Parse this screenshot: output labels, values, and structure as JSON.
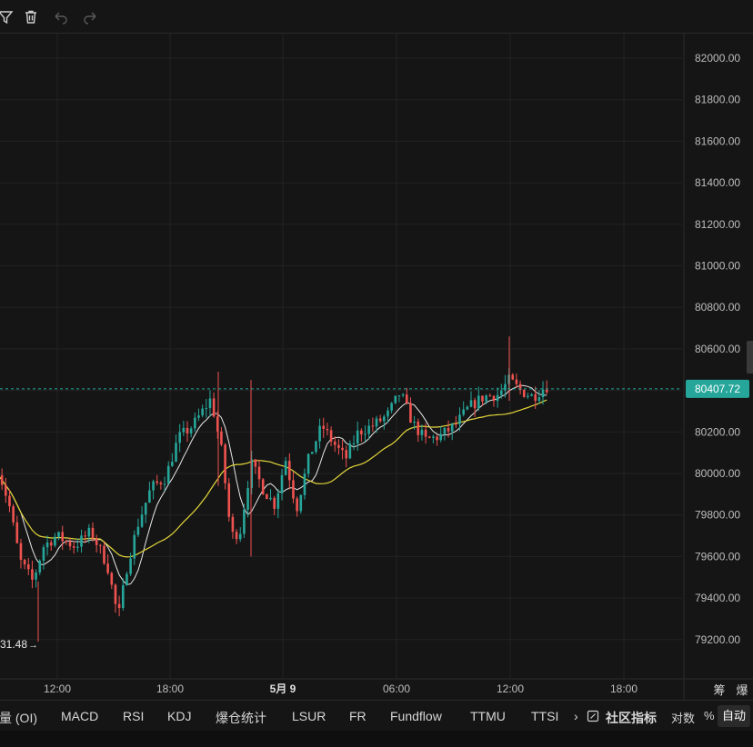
{
  "toolbar": {
    "icons": [
      "filter-icon",
      "trash-icon",
      "undo-icon",
      "redo-icon"
    ]
  },
  "chart_data": {
    "type": "candlestick",
    "y_ticks": [
      "82000.00",
      "81800.00",
      "81600.00",
      "81400.00",
      "81200.00",
      "81000.00",
      "80800.00",
      "80600.00",
      "80400.00",
      "80200.00",
      "80000.00",
      "79800.00",
      "79600.00",
      "79400.00",
      "79200.00"
    ],
    "x_ticks": [
      {
        "label": "12:00"
      },
      {
        "label": "18:00"
      },
      {
        "label": "5月 9",
        "bold": true
      },
      {
        "label": "06:00"
      },
      {
        "label": "12:00"
      },
      {
        "label": "18:00"
      }
    ],
    "side_labels": [
      "筹",
      "爆"
    ],
    "current_price": "80407.72",
    "low_marker": "31.48",
    "ylim": [
      79120,
      82080
    ],
    "colors": {
      "up": "#26a69a",
      "down": "#ef5350",
      "ma_short": "#e8e8e8",
      "ma_long": "#e5d83c",
      "price_tag": "#26a69a"
    }
  },
  "indicators": [
    {
      "label": "量 (OI)"
    },
    {
      "label": "MACD"
    },
    {
      "label": "RSI"
    },
    {
      "label": "KDJ"
    },
    {
      "label": "爆仓统计"
    },
    {
      "label": "LSUR"
    },
    {
      "label": "FR"
    },
    {
      "label": "Fundflow"
    },
    {
      "label": "TTMU"
    },
    {
      "label": "TTSI"
    }
  ],
  "bottom_right": {
    "more": "›",
    "community": "社区指标",
    "log": "对数",
    "percent": "%",
    "auto": "自动"
  }
}
